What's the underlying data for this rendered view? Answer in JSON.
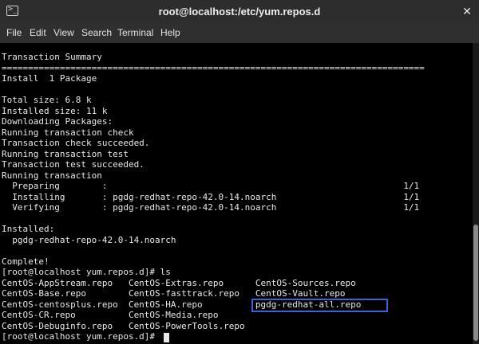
{
  "window": {
    "title": "root@localhost:/etc/yum.repos.d",
    "icon": "terminal-icon",
    "close_label": "✕"
  },
  "menu": {
    "file": "File",
    "edit": "Edit",
    "view": "View",
    "search": "Search",
    "terminal": "Terminal",
    "help": "Help"
  },
  "terminal": {
    "lines": {
      "l1": "Transaction Summary",
      "l2": "================================================================================",
      "l3": "Install  1 Package",
      "l4": "",
      "l5": "Total size: 6.8 k",
      "l6": "Installed size: 11 k",
      "l7": "Downloading Packages:",
      "l8": "Running transaction check",
      "l9": "Transaction check succeeded.",
      "l10": "Running transaction test",
      "l11": "Transaction test succeeded.",
      "l12": "Running transaction",
      "l13": "  Preparing        :                                                        1/1",
      "l14": "  Installing       : pgdg-redhat-repo-42.0-14.noarch                        1/1",
      "l15": "  Verifying        : pgdg-redhat-repo-42.0-14.noarch                        1/1",
      "l16": "",
      "l17": "Installed:",
      "l18": "  pgdg-redhat-repo-42.0-14.noarch",
      "l19": "",
      "l20": "Complete!",
      "l21": "[root@localhost yum.repos.d]# ls",
      "l22": "CentOS-AppStream.repo   CentOS-Extras.repo      CentOS-Sources.repo",
      "l23": "CentOS-Base.repo        CentOS-fasttrack.repo   CentOS-Vault.repo",
      "l24": "CentOS-centosplus.repo  CentOS-HA.repo          pgdg-redhat-all.repo",
      "l25": "CentOS-CR.repo          CentOS-Media.repo",
      "l26": "CentOS-Debuginfo.repo   CentOS-PowerTools.repo",
      "l27": "[root@localhost yum.repos.d]# "
    }
  },
  "colors": {
    "terminal_bg": "#000000",
    "terminal_fg": "#e8e8e8",
    "titlebar_bg": "#2d2d2d",
    "highlight": "#3a63d6"
  }
}
